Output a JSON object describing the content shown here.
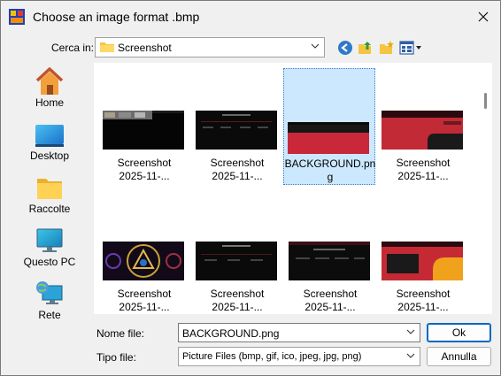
{
  "window": {
    "title": "Choose an image format .bmp",
    "app_icon": "paint-app-icon",
    "close_icon": "close-icon"
  },
  "lookin": {
    "label": "Cerca in:",
    "value": "Screenshot"
  },
  "toolbar": {
    "icons": [
      "back-icon",
      "up-folder-icon",
      "new-folder-icon",
      "view-menu-icon"
    ]
  },
  "places": [
    {
      "label": "Home",
      "icon": "home-icon"
    },
    {
      "label": "Desktop",
      "icon": "desktop-icon"
    },
    {
      "label": "Raccolte",
      "icon": "folder-icon"
    },
    {
      "label": "Questo PC",
      "icon": "computer-icon"
    },
    {
      "label": "Rete",
      "icon": "network-icon"
    }
  ],
  "files": [
    {
      "line1": "Screenshot",
      "line2": "2025-11-...",
      "selected": false
    },
    {
      "line1": "Screenshot",
      "line2": "2025-11-...",
      "selected": false
    },
    {
      "line1": "BACKGROUND.pn",
      "line2": "g",
      "selected": true
    },
    {
      "line1": "Screenshot",
      "line2": "2025-11-...",
      "selected": false
    },
    {
      "line1": "Screenshot",
      "line2": "2025-11-...",
      "selected": false
    },
    {
      "line1": "Screenshot",
      "line2": "2025-11-...",
      "selected": false
    },
    {
      "line1": "Screenshot",
      "line2": "2025-11-...",
      "selected": false
    },
    {
      "line1": "Screenshot",
      "line2": "2025-11-...",
      "selected": false
    }
  ],
  "filename": {
    "label": "Nome file:",
    "value": "BACKGROUND.png"
  },
  "filetype": {
    "label": "Tipo file:",
    "value": "Picture Files (bmp, gif, ico, jpeg, jpg, png)"
  },
  "buttons": {
    "ok": "Ok",
    "cancel": "Annulla"
  },
  "colors": {
    "selection": "#cce8ff",
    "accent": "#0067c0",
    "thumb_red": "#c8283a"
  }
}
